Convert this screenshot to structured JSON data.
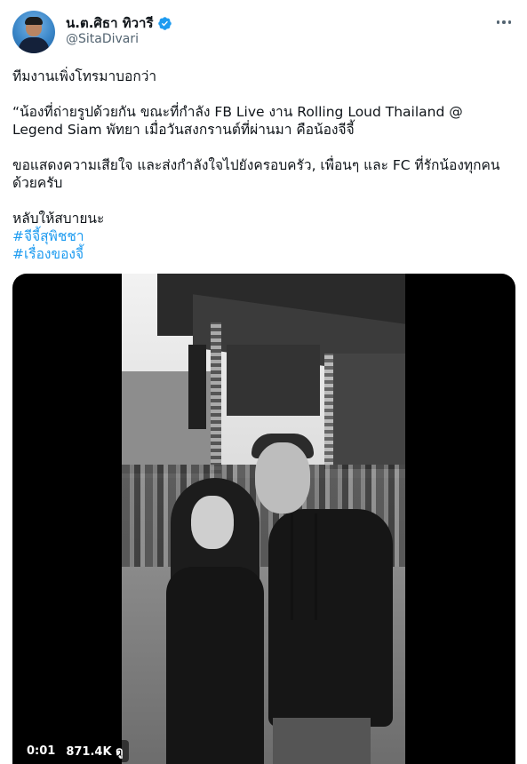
{
  "author": {
    "display_name": "น.ต.ศิธา ทิวารี",
    "handle": "@SitaDivari",
    "verified": true
  },
  "icons": {
    "avatar": "profile-avatar",
    "verified": "verified-badge-icon",
    "more": "more-options-icon"
  },
  "colors": {
    "link": "#1d9bf0",
    "verified": "#1d9bf0",
    "text": "#0f1419",
    "secondary": "#536471"
  },
  "tweet": {
    "line1": "ทีมงานเพิ่งโทรมาบอกว่า",
    "paragraph2": "“น้องที่ถ่ายรูปด้วยกัน ขณะที่กำลัง FB Live งาน Rolling Loud Thailand @ Legend Siam พัทยา เมื่อวันสงกรานต์ที่ผ่านมา คือน้องจีจี้",
    "paragraph3": "ขอแสดงความเสียใจ และส่งกำลังใจไปยังครอบครัว, เพื่อนๆ และ FC ที่รักน้องทุกคนด้วยครับ",
    "line4": "หลับให้สบายนะ",
    "hashtags": [
      "#จีจี้สุพิชชา",
      "#เรื่องของจี้"
    ]
  },
  "video": {
    "elapsed": "0:01",
    "views": "871.4K ดู"
  }
}
